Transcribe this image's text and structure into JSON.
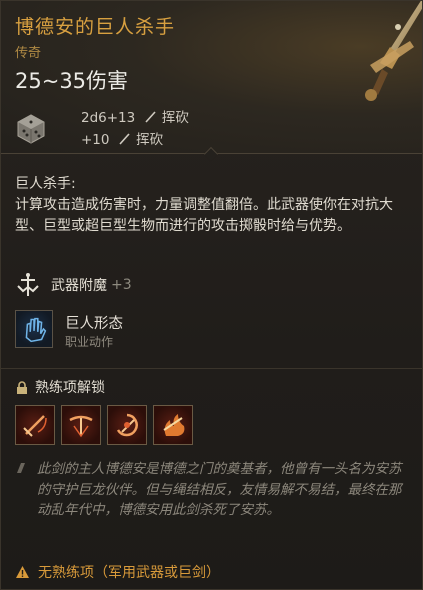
{
  "item": {
    "name": "博德安的巨人杀手",
    "rarity": "传奇",
    "damage_range": "25~35伤害",
    "damage_lines": [
      {
        "amount": "2d6+13",
        "type": "挥砍"
      },
      {
        "amount": "+10",
        "type": "挥砍"
      }
    ]
  },
  "description": {
    "title": "巨人杀手:",
    "body": "计算攻击造成伤害时，力量调整值翻倍。此武器使你在对抗大型、巨型或超巨型生物而进行的攻击掷骰时给与优势。"
  },
  "enchant": {
    "label": "武器附魔",
    "value": "+3"
  },
  "action": {
    "name": "巨人形态",
    "type": "职业动作"
  },
  "proficiency": {
    "heading": "熟练项解锁",
    "icons": [
      "sword-slash-icon",
      "cleave-icon",
      "spin-slash-icon",
      "fire-strike-icon"
    ]
  },
  "lore": "此剑的主人博德安是博德之门的奠基者，他曾有一头名为安苏的守护巨龙伙伴。但与绳结相反，友情易解不易结，最终在那动乱年代中，博德安用此剑杀死了安苏。",
  "warning": "无熟练项（军用武器或巨剑）",
  "colors": {
    "title": "#d8a040",
    "rarity": "#b08a44",
    "warning": "#d89a3a"
  }
}
